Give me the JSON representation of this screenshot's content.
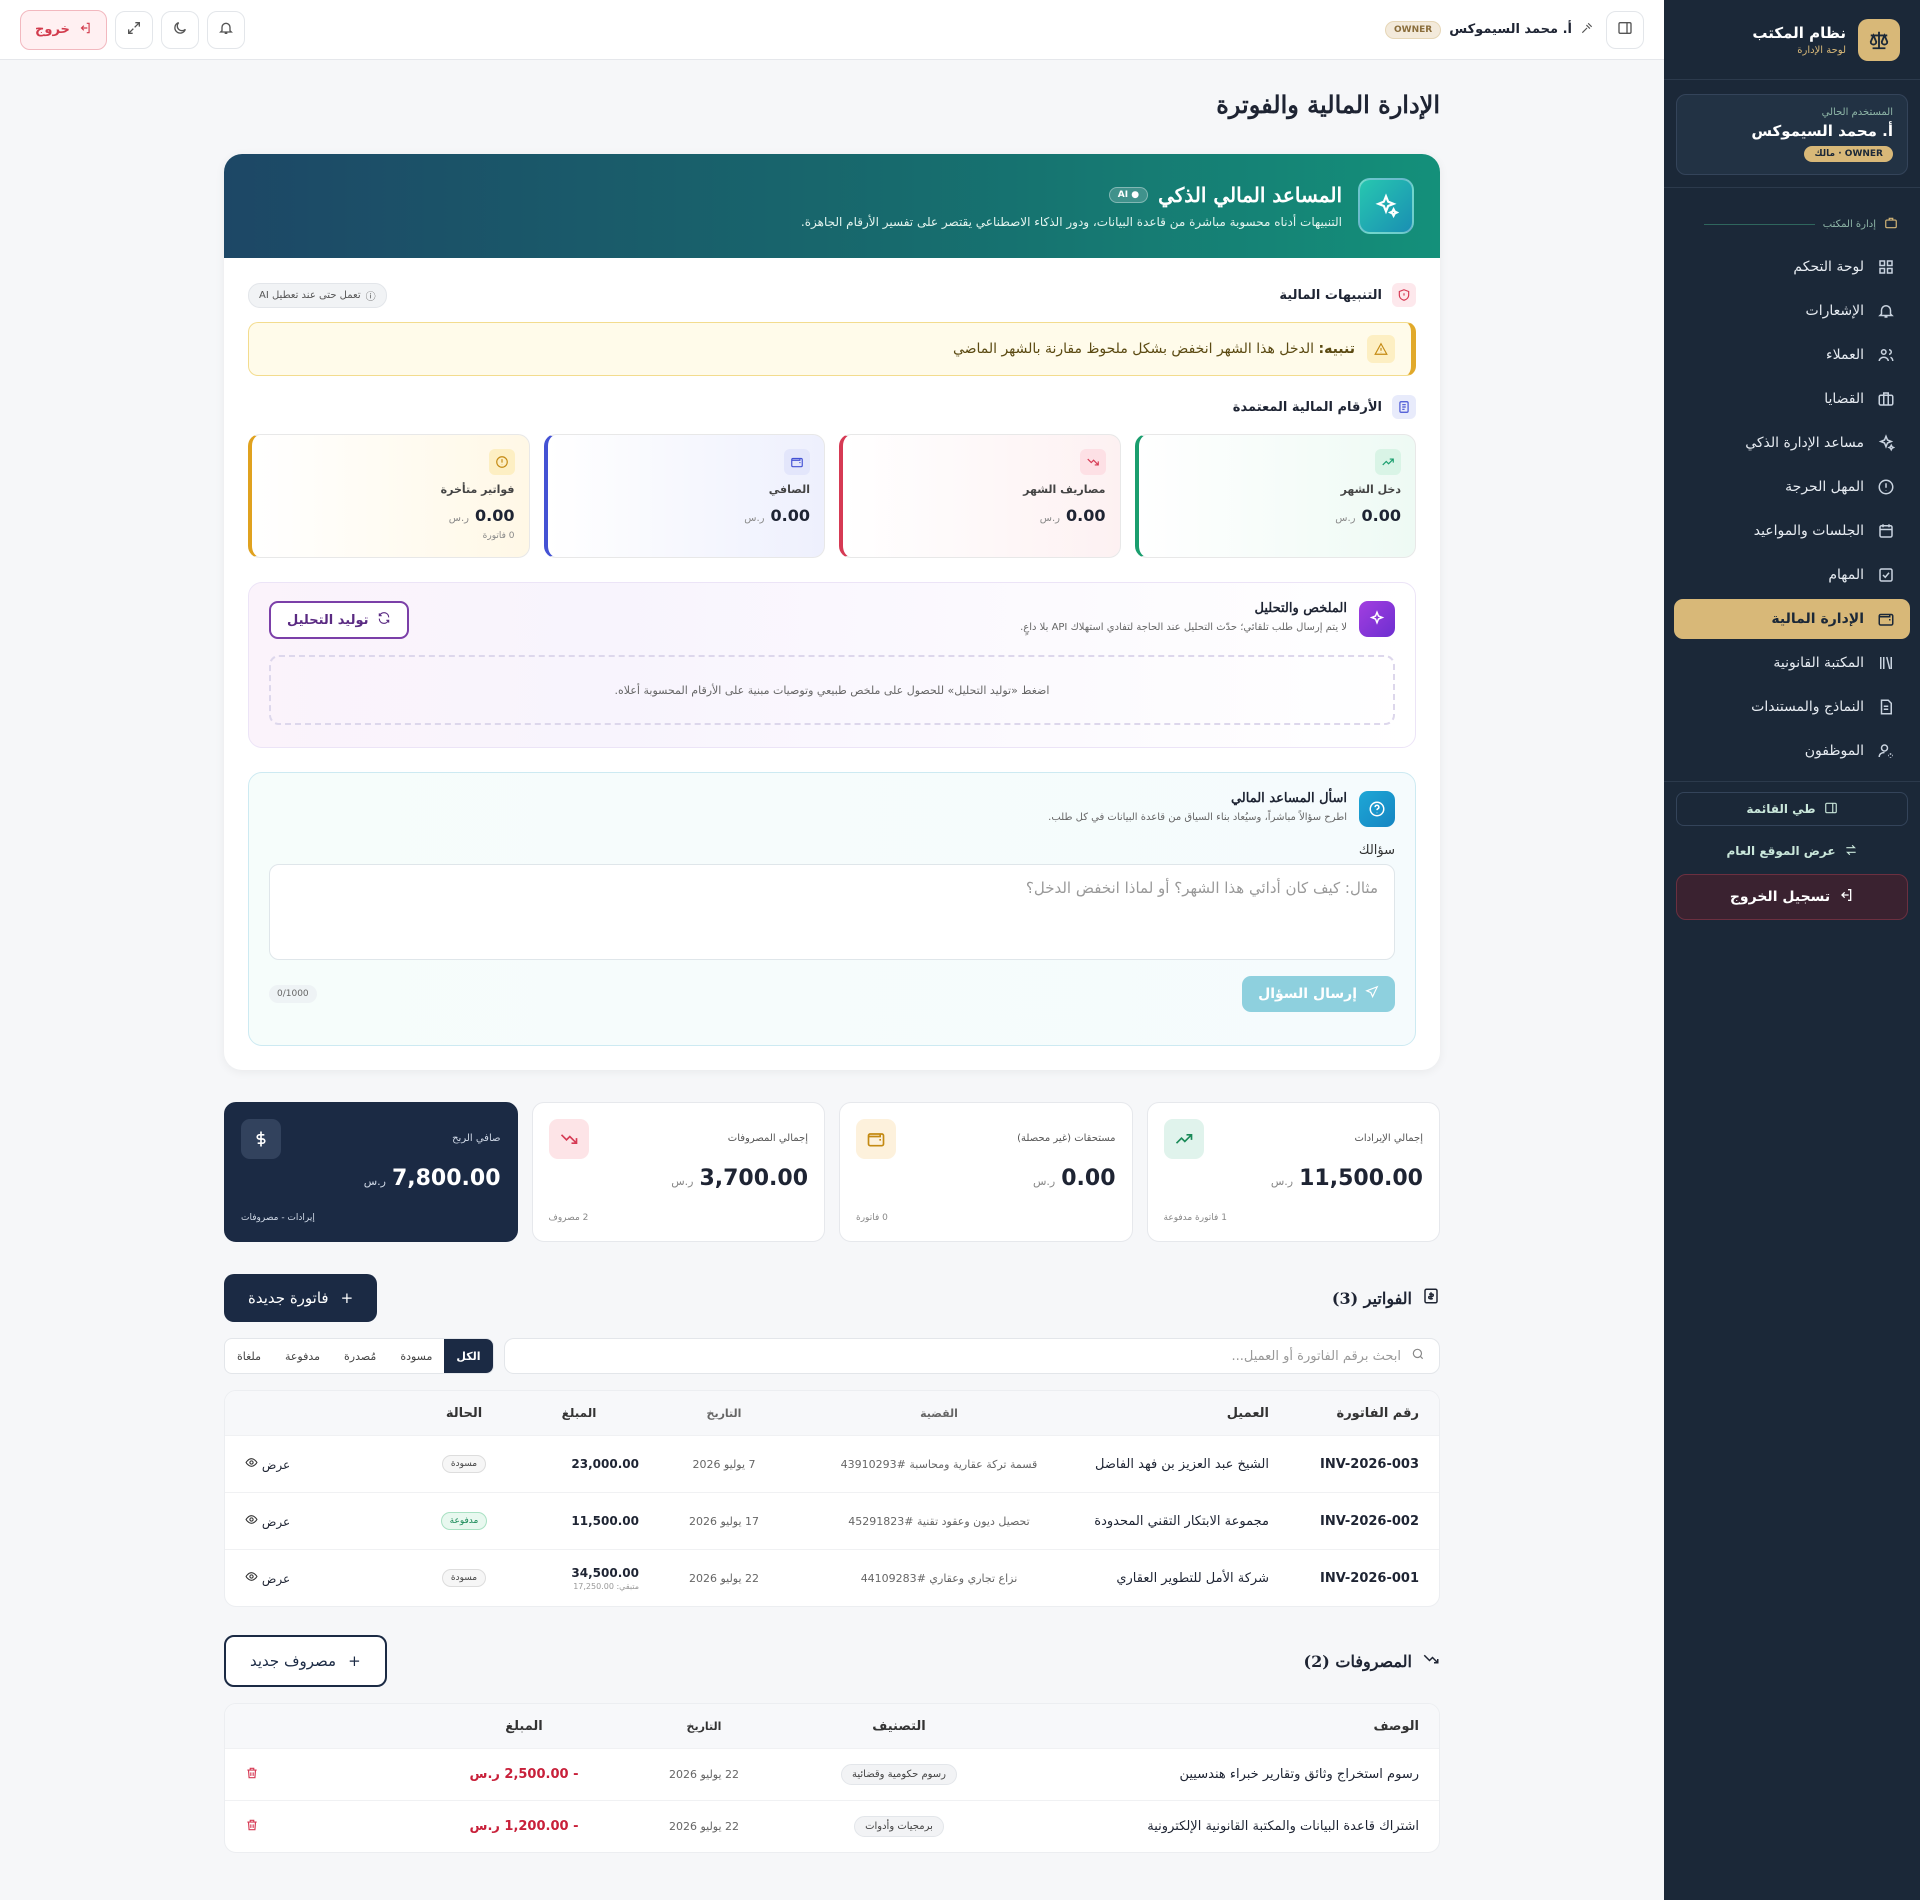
{
  "sidebar": {
    "brand_title": "نظام المكتب",
    "brand_sub": "لوحة الإدارة",
    "user_caption": "المستخدم الحالي",
    "user_name": "أ. محمد السيموكس",
    "user_badge": "OWNER · مالك",
    "section_label": "إدارة المكتب",
    "items": [
      {
        "label": "لوحة التحكم",
        "icon": "grid-icon"
      },
      {
        "label": "الإشعارات",
        "icon": "bell-icon"
      },
      {
        "label": "العملاء",
        "icon": "users-icon"
      },
      {
        "label": "القضايا",
        "icon": "briefcase-icon"
      },
      {
        "label": "مساعد الإدارة الذكي",
        "icon": "sparkles-icon"
      },
      {
        "label": "المهل الحرجة",
        "icon": "alert-circle-icon"
      },
      {
        "label": "الجلسات والمواعيد",
        "icon": "calendar-icon"
      },
      {
        "label": "المهام",
        "icon": "check-square-icon"
      },
      {
        "label": "الإدارة المالية",
        "icon": "wallet-icon",
        "active": true
      },
      {
        "label": "المكتبة القانونية",
        "icon": "library-icon"
      },
      {
        "label": "النماذج والمستندات",
        "icon": "file-text-icon"
      },
      {
        "label": "الموظفون",
        "icon": "user-cog-icon"
      }
    ],
    "collapse_label": "طي القائمة",
    "public_label": "عرض الموقع العام",
    "logout_label": "تسجيل الخروج"
  },
  "topbar": {
    "user_name": "أ. محمد السيموكس",
    "role": "OWNER",
    "exit_label": "خروج"
  },
  "page": {
    "title": "الإدارة المالية والفوترة"
  },
  "ai": {
    "title": "المساعد المالي الذكي",
    "pill": "AI",
    "subtitle": "التنبيهات أدناه محسوبة مباشرة من قاعدة البيانات، ودور الذكاء الاصطناعي يقتصر على تفسير الأرقام الجاهزة.",
    "alerts_title": "التنبيهات المالية",
    "alerts_chip": "تعمل حتى عند تعطيل AI",
    "alert_prefix": "تنبيه:",
    "alert_text": "الدخل هذا الشهر انخفض بشكل ملحوظ مقارنة بالشهر الماضي",
    "figures_title": "الأرقام المالية المعتمدة",
    "kpis": [
      {
        "label": "دخل الشهر",
        "value": "0.00",
        "currency": "ر.س",
        "foot": "",
        "tone": "green"
      },
      {
        "label": "مصاريف الشهر",
        "value": "0.00",
        "currency": "ر.س",
        "foot": "",
        "tone": "red"
      },
      {
        "label": "الصافي",
        "value": "0.00",
        "currency": "ر.س",
        "foot": "",
        "tone": "blue"
      },
      {
        "label": "فواتير متأخرة",
        "value": "0.00",
        "currency": "ر.س",
        "foot": "0 فاتورة",
        "tone": "amber"
      }
    ],
    "summary_title": "الملخص والتحليل",
    "summary_sub": "لا يتم إرسال طلب تلقائي؛ حدّث التحليل عند الحاجة لتفادي استهلاك API بلا داعٍ.",
    "summary_button": "توليد التحليل",
    "summary_placeholder": "اضغط «توليد التحليل» للحصول على ملخص طبيعي وتوصيات مبنية على الأرقام المحسوبة أعلاه.",
    "ask_title": "اسأل المساعد المالي",
    "ask_sub": "اطرح سؤالاً مباشراً، وسيُعاد بناء السياق من قاعدة البيانات في كل طلب.",
    "ask_label": "سؤالك",
    "ask_placeholder": "مثال: كيف كان أدائي هذا الشهر؟ أو لماذا انخفض الدخل؟",
    "ask_counter": "0/1000",
    "ask_button": "إرسال السؤال"
  },
  "stats": [
    {
      "label": "إجمالي الإيرادات",
      "value": "11,500.00",
      "currency": "ر.س",
      "foot": "1 فاتورة مدفوعة",
      "icon": "trending-up-icon"
    },
    {
      "label": "مستحقات (غير محصلة)",
      "value": "0.00",
      "currency": "ر.س",
      "foot": "0 فاتورة",
      "icon": "wallet-icon"
    },
    {
      "label": "إجمالي المصروفات",
      "value": "3,700.00",
      "currency": "ر.س",
      "foot": "2 مصروف",
      "icon": "trending-down-icon"
    },
    {
      "label": "صافي الربح",
      "value": "7,800.00",
      "currency": "ر.س",
      "foot": "إيرادات - مصروفات",
      "icon": "dollar-icon"
    }
  ],
  "invoices": {
    "title": "الفواتير (3)",
    "new_button": "فاتورة جديدة",
    "search_placeholder": "ابحث برقم الفاتورة أو العميل...",
    "tabs": [
      "الكل",
      "مسودة",
      "مُصدرة",
      "مدفوعة",
      "ملغاة"
    ],
    "columns": [
      "رقم الفاتورة",
      "العميل",
      "القضية",
      "التاريخ",
      "المبلغ",
      "الحالة"
    ],
    "rows": [
      {
        "number": "INV-2026-003",
        "client": "الشيخ عبد العزيز بن فهد الفاضل",
        "case": "قسمة تركة عقارية ومحاسبة #43910293",
        "date": "7 يوليو 2026",
        "amount": "23,000.00",
        "remaining": "",
        "status": "مسودة",
        "paid": false,
        "action": "عرض"
      },
      {
        "number": "INV-2026-002",
        "client": "مجموعة الابتكار التقني المحدودة",
        "case": "تحصيل ديون وعقود تقنية #45291823",
        "date": "17 يوليو 2026",
        "amount": "11,500.00",
        "remaining": "",
        "status": "مدفوعة",
        "paid": true,
        "action": "عرض"
      },
      {
        "number": "INV-2026-001",
        "client": "شركة الأمل للتطوير العقاري",
        "case": "نزاع تجاري وعقاري #44109283",
        "date": "22 يوليو 2026",
        "amount": "34,500.00",
        "remaining": "متبقي: 17,250.00",
        "status": "مسودة",
        "paid": false,
        "action": "عرض"
      }
    ]
  },
  "expenses": {
    "title": "المصروفات (2)",
    "new_button": "مصروف جديد",
    "columns": [
      "الوصف",
      "التصنيف",
      "التاريخ",
      "المبلغ"
    ],
    "rows": [
      {
        "desc": "رسوم استخراج وثائق وتقارير خبراء هندسيين",
        "category": "رسوم حكومية وقضائية",
        "date": "22 يوليو 2026",
        "amount": "- 2,500.00 ر.س"
      },
      {
        "desc": "اشتراك قاعدة البيانات والمكتبة القانونية الإلكترونية",
        "category": "برمجيات وأدوات",
        "date": "22 يوليو 2026",
        "amount": "- 1,200.00 ر.س"
      }
    ]
  }
}
